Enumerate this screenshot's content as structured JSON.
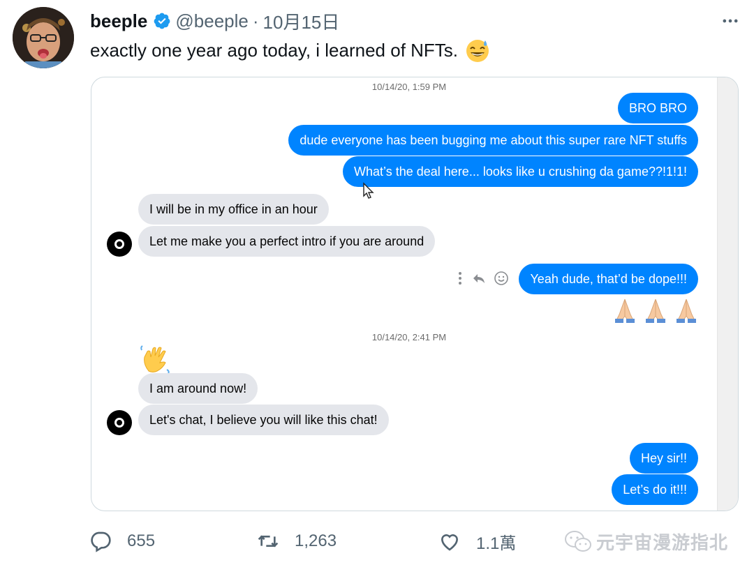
{
  "tweet": {
    "author_name": "beeple",
    "verified_icon": "verified-badge-icon",
    "handle": "@beeple",
    "separator": "·",
    "date": "10月15日",
    "text": "exactly one year ago today, i learned of NFTs.",
    "text_emoji": "grinning-sweat-emoji"
  },
  "chat": {
    "timestamp_1": "10/14/20, 1:59 PM",
    "timestamp_2": "10/14/20, 2:41 PM",
    "messages": [
      {
        "side": "out",
        "text": "BRO BRO"
      },
      {
        "side": "out",
        "text": "dude everyone has been bugging me about this super rare NFT stuffs"
      },
      {
        "side": "out",
        "text": "What’s the deal here... looks like u crushing da game??!1!1!"
      },
      {
        "side": "in",
        "text": "I will be in my office in an hour"
      },
      {
        "side": "in",
        "text": "Let me make you a perfect intro if you are around"
      },
      {
        "side": "out",
        "text": "Yeah dude, that’d be dope!!!"
      },
      {
        "side": "in",
        "text": "I am around now!"
      },
      {
        "side": "in",
        "text": "Let's chat, I believe you will like this chat!"
      },
      {
        "side": "out",
        "text": "Hey sir!!"
      },
      {
        "side": "out",
        "text": "Let’s do it!!!"
      }
    ],
    "colors": {
      "outgoing": "#0084ff",
      "incoming": "#e4e6eb"
    }
  },
  "actions": {
    "replies": "655",
    "retweets": "1,263",
    "likes": "1.1萬"
  },
  "watermark": {
    "text": "元宇宙漫游指北",
    "icon": "wechat-icon"
  }
}
